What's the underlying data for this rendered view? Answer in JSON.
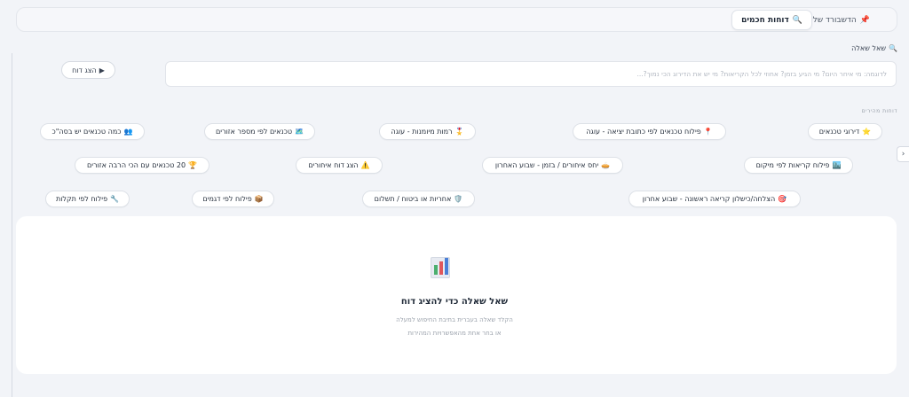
{
  "tabs": {
    "mine": {
      "icon": "📌",
      "label": "הדשבורד שלי"
    },
    "smart": {
      "icon": "🔍",
      "label": "דוחות חכמים"
    }
  },
  "ask": {
    "icon": "🔍",
    "label": "שאל שאלה",
    "placeholder": "לדוגמה: מי איחר היום? מי הגיע בזמן? אחוזי לכל הקריאות? מי יש את הדירוג הכי נמוך?...",
    "button_icon": "▶",
    "button_label": "הצג דוח"
  },
  "prebuilt": {
    "label": "דוחות מהירים"
  },
  "chips": [
    {
      "icon": "⭐",
      "label": "דירוגי טכנאים"
    },
    {
      "icon": "📍",
      "label": "פילוח טכנאים לפי כתובת יציאה - עוגה"
    },
    {
      "icon": "🎖️",
      "label": "רמות מיומנות - עוגה"
    },
    {
      "icon": "🗺️",
      "label": "טכנאים לפי מספר אזורים"
    },
    {
      "icon": "👥",
      "label": "כמה טכנאים יש בסה\"כ"
    },
    {
      "icon": "🏙️",
      "label": "פילוח קריאות לפי מיקום"
    },
    {
      "icon": "🥧",
      "label": "יחס איחורים / בזמן - שבוע האחרון"
    },
    {
      "icon": "⚠️",
      "label": "הצג דוח איחורים"
    },
    {
      "icon": "🏆",
      "label": "20 טכנאים עם הכי הרבה אזורים"
    },
    {
      "icon": "🎯",
      "label": "הצלחה/כישלון קריאה ראשונה - שבוע אחרון"
    },
    {
      "icon": "🛡️",
      "label": "אחריות או ביטוח / תשלום"
    },
    {
      "icon": "📦",
      "label": "פילוח לפי דגמים"
    },
    {
      "icon": "🔧",
      "label": "פילוח לפי תקלות"
    }
  ],
  "side_toggle": {
    "icon": "‹"
  },
  "empty": {
    "icon": "bar-chart-icon",
    "title": "שאל שאלה כדי להציג דוח",
    "line1": "הקלד שאלה בעברית בתיבת החיפוש למעלה",
    "line2": "או בחר אחת מהאפשרויות המהירות"
  },
  "colors": {
    "background": "#f2f4f8",
    "bar_green": "#4caf6e",
    "bar_red": "#e0575b",
    "bar_blue": "#4a7fd6"
  }
}
